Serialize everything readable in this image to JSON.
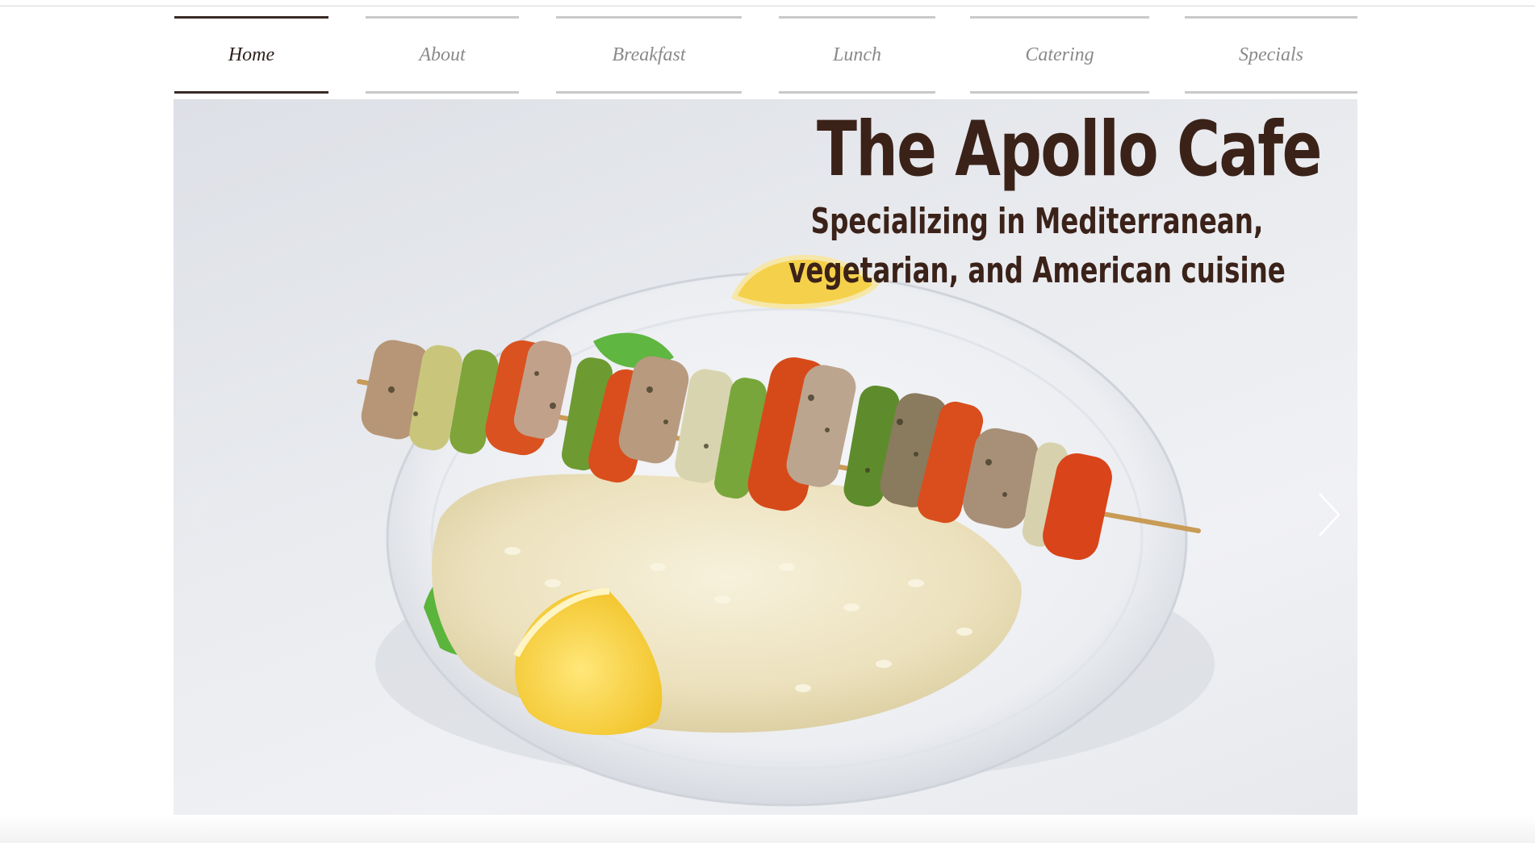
{
  "nav": {
    "items": [
      {
        "label": "Home",
        "active": true
      },
      {
        "label": "About",
        "active": false
      },
      {
        "label": "Breakfast",
        "active": false
      },
      {
        "label": "Lunch",
        "active": false
      },
      {
        "label": "Catering",
        "active": false
      },
      {
        "label": "Specials",
        "active": false
      }
    ]
  },
  "hero": {
    "title": "The Apollo Cafe",
    "subtitle": "Specializing in Mediterranean, vegetarian, and American cuisine",
    "image_description_icon": "food-plate-image",
    "prev_icon": "chevron-left-icon",
    "next_icon": "chevron-right-icon"
  },
  "colors": {
    "title": "#3b2219",
    "nav_active": "#2c1f1b",
    "nav_inactive": "#8a8a8a",
    "nav_border": "#c9c9c9"
  }
}
